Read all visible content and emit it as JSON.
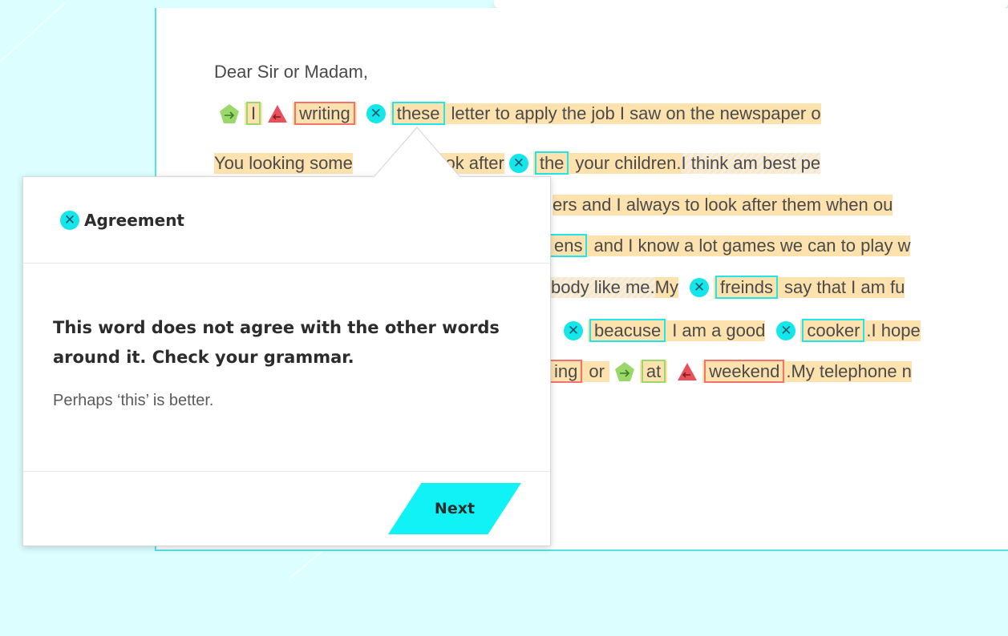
{
  "document": {
    "greeting": "Dear Sir or Madam,",
    "line1": {
      "w_i": "I",
      "w_writing": "writing",
      "w_these": "these",
      "t_rest": "letter to apply the job I saw on the newspaper o"
    },
    "line2": {
      "t_start": "You looking some",
      "t_mid": "to look after",
      "w_the": "the",
      "t_rest": "your children.",
      "t_hatch": "I think am best pe"
    },
    "line3": {
      "t_rest": "ers and I always to look after them when ou"
    },
    "line4": {
      "w_ens": "ens",
      "t_rest": "and I know a lot games we can to play w"
    },
    "line5": {
      "t_hatch": "body like me.",
      "t_my": "My",
      "w_freinds": "freinds",
      "t_rest": "say that I am fu"
    },
    "line6": {
      "w_beacuse": "beacuse",
      "t_mid": "I am a good",
      "w_cooker": "cooker",
      "t_rest": ".I hope"
    },
    "line7": {
      "w_ing": "ing",
      "t_or": "or",
      "w_at": "at",
      "w_weekend": "weekend",
      "t_rest": ".My telephone n"
    }
  },
  "popup": {
    "category": "Agreement",
    "message": "This word does not agree with the other words around it. Check your grammar.",
    "suggestion": "Perhaps ‘this’ is better.",
    "next_label": "Next"
  },
  "icons": {
    "agreement": "x-circle-icon",
    "missing_word": "arrow-pentagon-icon",
    "wrong_word": "arrow-triangle-icon"
  },
  "colors": {
    "accent_cyan": "#14e6ea",
    "highlight": "#fde2ae",
    "error_red": "#f0746b",
    "insert_green": "#9ad86a",
    "background": "#dcfeff"
  }
}
